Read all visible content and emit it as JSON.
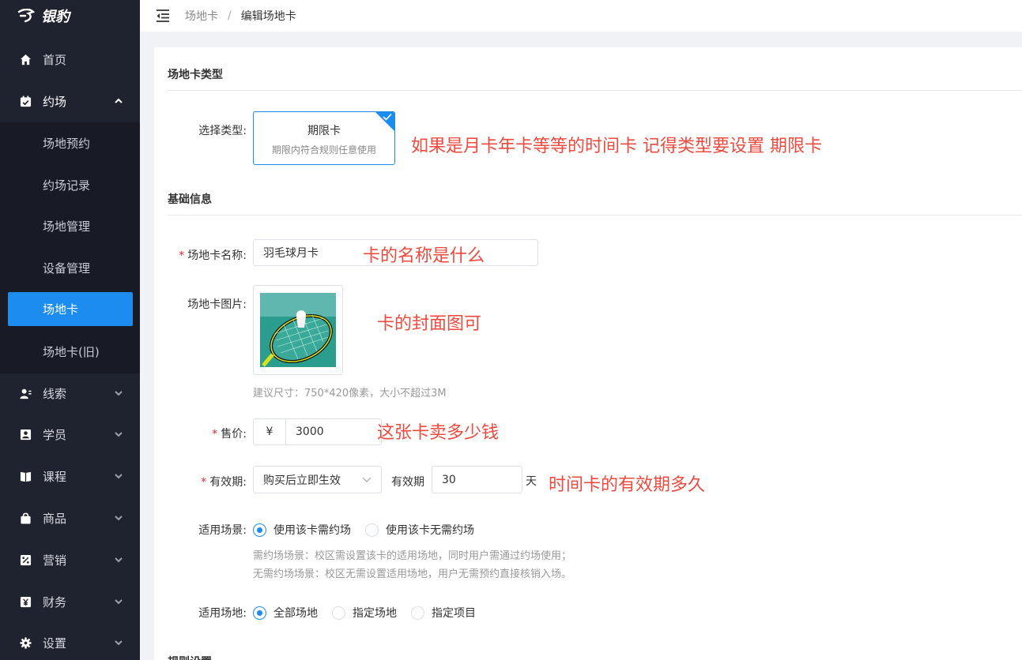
{
  "app": {
    "logo_text": "银豹"
  },
  "sidebar": {
    "items": [
      {
        "label": "首页",
        "icon": "home-icon"
      },
      {
        "label": "约场",
        "icon": "calendar-check-icon",
        "expanded": true
      },
      {
        "label": "线索",
        "icon": "user-clue-icon"
      },
      {
        "label": "学员",
        "icon": "student-card-icon"
      },
      {
        "label": "课程",
        "icon": "book-icon"
      },
      {
        "label": "商品",
        "icon": "shopping-bag-icon"
      },
      {
        "label": "营销",
        "icon": "percent-icon"
      },
      {
        "label": "财务",
        "icon": "yen-icon"
      },
      {
        "label": "设置",
        "icon": "gear-icon"
      }
    ],
    "submenu": [
      {
        "label": "场地预约"
      },
      {
        "label": "约场记录"
      },
      {
        "label": "场地管理"
      },
      {
        "label": "设备管理"
      },
      {
        "label": "场地卡",
        "active": true
      },
      {
        "label": "场地卡(旧)"
      }
    ]
  },
  "header": {
    "breadcrumb_parent": "场地卡",
    "breadcrumb_sep": "/",
    "breadcrumb_current": "编辑场地卡"
  },
  "form": {
    "section_type": "场地卡类型",
    "type_label": "选择类型:",
    "type_card_title": "期限卡",
    "type_card_desc": "期限内符合规则任意使用",
    "section_basic": "基础信息",
    "name_label": "场地卡名称:",
    "name_value": "羽毛球月卡",
    "image_label": "场地卡图片:",
    "image_hint": "建议尺寸：750*420像素，大小不超过3M",
    "price_label": "售价:",
    "price_prefix": "¥",
    "price_value": "3000",
    "validity_label": "有效期:",
    "validity_select": "购买后立即生效",
    "validity_sub_label": "有效期",
    "validity_value": "30",
    "validity_unit": "天",
    "scene_label": "适用场景:",
    "scene_options": [
      "使用该卡需约场",
      "使用该卡无需约场"
    ],
    "scene_selected": 0,
    "scene_hint_1": "需约场场景：校区需设置该卡的适用场地，同时用户需通过约场使用；",
    "scene_hint_2": "无需约场场景：校区无需设置适用场地，用户无需预约直接核销入场。",
    "venue_label": "适用场地:",
    "venue_options": [
      "全部场地",
      "指定场地",
      "指定项目"
    ],
    "venue_selected": 0,
    "section_rules": "规则设置"
  },
  "annotations": {
    "type_note": "如果是月卡年卡等等的时间卡 记得类型要设置 期限卡",
    "name_note": "卡的名称是什么",
    "image_note": "卡的封面图可",
    "price_note": "这张卡卖多少钱",
    "validity_note": "时间卡的有效期多久"
  },
  "colors": {
    "primary": "#1c8cf0",
    "sidebar": "#1f2330",
    "annotation": "#f04a3e",
    "required": "#f5222d"
  }
}
